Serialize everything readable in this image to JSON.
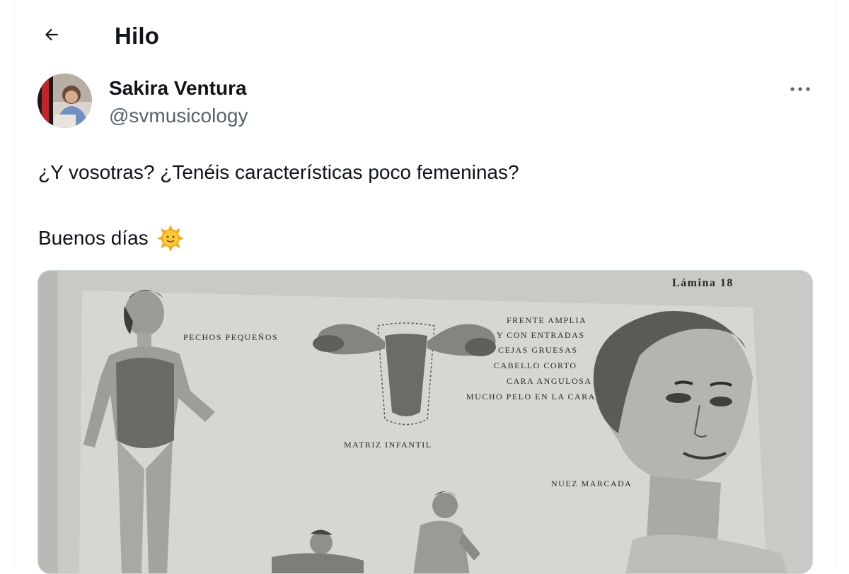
{
  "header": {
    "title": "Hilo"
  },
  "author": {
    "name": "Sakira Ventura",
    "handle": "@svmusicology"
  },
  "tweet": {
    "line1": "¿Y vosotras? ¿Tenéis características poco femeninas?",
    "line2": "Buenos días",
    "emoji": "sun-with-face"
  },
  "media": {
    "plate_title": "Lámina 18",
    "labels": {
      "pechos": "PECHOS PEQUEÑOS",
      "matriz": "MATRIZ INFANTIL",
      "frente1": "FRENTE AMPLIA",
      "frente2": "Y CON ENTRADAS",
      "cejas": "CEJAS GRUESAS",
      "cabello": "CABELLO CORTO",
      "cara": "CARA ANGULOSA",
      "pelo": "MUCHO PELO EN LA CARA",
      "nuez": "NUEZ MARCADA"
    }
  },
  "colors": {
    "text": "#0f1419",
    "secondary": "#536471",
    "border": "#cfd9de"
  }
}
